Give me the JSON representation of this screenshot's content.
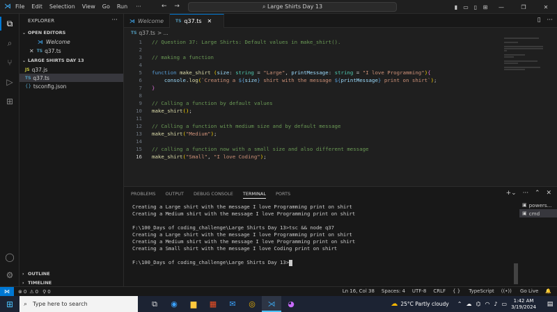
{
  "titlebar": {
    "menu": [
      "File",
      "Edit",
      "Selection",
      "View",
      "Go",
      "Run"
    ],
    "more": "···",
    "search_text": "Large Shirts Day 13"
  },
  "sidebar": {
    "header": "EXPLORER",
    "more": "···",
    "open_editors_label": "OPEN EDITORS",
    "open_editors": [
      {
        "icon": "vscode-icon",
        "label": "Welcome"
      },
      {
        "icon": "ts-file-icon",
        "label": "q37.ts"
      }
    ],
    "folder_label": "LARGE SHIRTS DAY 13",
    "files": [
      {
        "type": "js",
        "badge": "JS",
        "label": "q37.js"
      },
      {
        "type": "ts",
        "badge": "TS",
        "label": "q37.ts"
      },
      {
        "type": "cfg",
        "badge": "{}",
        "label": "tsconfig.json"
      }
    ],
    "outline_label": "OUTLINE",
    "timeline_label": "TIMELINE"
  },
  "tabs": [
    {
      "label": "Welcome",
      "active": false
    },
    {
      "label": "q37.ts",
      "active": true
    }
  ],
  "breadcrumb": {
    "file": "q37.ts",
    "rest": "> ..."
  },
  "editor": {
    "lines": [
      {
        "n": "1",
        "html": "<span class='cm'>// Question 37: Large Shirts: Default values in make_shirt().</span>"
      },
      {
        "n": "2",
        "html": ""
      },
      {
        "n": "3",
        "html": "<span class='cm'>// making a function</span>"
      },
      {
        "n": "4",
        "html": ""
      },
      {
        "n": "5",
        "html": "<span class='kw'>function</span> <span class='fn'>make_shirt</span> <span class='br'>(</span><span class='pm'>size</span><span class='tx'>: </span><span class='ty'>string</span><span class='tx'> = </span><span class='st'>\"Large\"</span><span class='tx'>, </span><span class='pm'>printMessage</span><span class='tx'>: </span><span class='ty'>string</span><span class='tx'> = </span><span class='st'>\"I love Programming\"</span><span class='br'>)</span><span class='br2'>{</span>"
      },
      {
        "n": "6",
        "html": "    <span class='pm'>console</span><span class='tx'>.</span><span class='fn'>log</span><span class='br'>(</span><span class='st'>`Creating a </span><span class='kw'>${</span><span class='pm'>size</span><span class='kw'>}</span><span class='st'> shirt with the message </span><span class='kw'>${</span><span class='pm'>printMessage</span><span class='kw'>}</span><span class='st'> print on shirt`</span><span class='br'>)</span><span class='tx'>;</span>"
      },
      {
        "n": "7",
        "html": "<span class='br2'>}</span>"
      },
      {
        "n": "8",
        "html": ""
      },
      {
        "n": "9",
        "html": "<span class='cm'>// Calling a function by default values</span>"
      },
      {
        "n": "10",
        "html": "<span class='fn'>make_shirt</span><span class='br'>()</span><span class='tx'>;</span>"
      },
      {
        "n": "11",
        "html": ""
      },
      {
        "n": "12",
        "html": "<span class='cm'>// Calling a function with medium size and by default message</span>"
      },
      {
        "n": "13",
        "html": "<span class='fn'>make_shirt</span><span class='br'>(</span><span class='st'>\"Medium\"</span><span class='br'>)</span><span class='tx'>;</span>"
      },
      {
        "n": "14",
        "html": ""
      },
      {
        "n": "15",
        "html": "<span class='cm'>// calling a function now with a small size and also different message</span>"
      },
      {
        "n": "16",
        "html": "<span class='fn'>make_shirt</span><span class='br'>(</span><span class='st'>\"Small\"</span><span class='tx'>, </span><span class='st'>\"I love Coding\"</span><span class='br'>)</span><span class='tx'>;</span>"
      }
    ],
    "current_line": "16"
  },
  "panel": {
    "tabs": [
      "PROBLEMS",
      "OUTPUT",
      "DEBUG CONSOLE",
      "TERMINAL",
      "PORTS"
    ],
    "active_tab": "TERMINAL",
    "terminal_lines": [
      "Creating a Large shirt with the message I love Programming print on shirt",
      "Creating a Medium shirt with the message I love Programming print on shirt",
      "",
      "F:\\100_Days of coding_challenge\\Large Shirts Day 13>tsc && node q37",
      "Creating a Large shirt with the message I love Programming print on shirt",
      "Creating a Medium shirt with the message I love Programming print on shirt",
      "Creating a Small shirt with the message I love Coding print on shirt",
      "",
      "F:\\100_Days of coding_challenge\\Large Shirts Day 13>"
    ],
    "terminals": [
      {
        "label": "powers...",
        "selected": false
      },
      {
        "label": "cmd",
        "selected": true
      }
    ]
  },
  "statusbar": {
    "errors": "0",
    "warnings": "0",
    "ports": "0",
    "position": "Ln 16, Col 38",
    "spaces": "Spaces: 4",
    "encoding": "UTF-8",
    "eol": "CRLF",
    "language": "TypeScript",
    "golive": "Go Live"
  },
  "taskbar": {
    "search_placeholder": "Type here to search",
    "weather": "25°C  Partly cloudy",
    "time": "1:42 AM",
    "date": "3/19/2024"
  },
  "colors": {
    "accent": "#0078d4",
    "editor_bg": "#1f1f1f",
    "sidebar_bg": "#181818",
    "taskbar_bg": "#1c2333"
  }
}
